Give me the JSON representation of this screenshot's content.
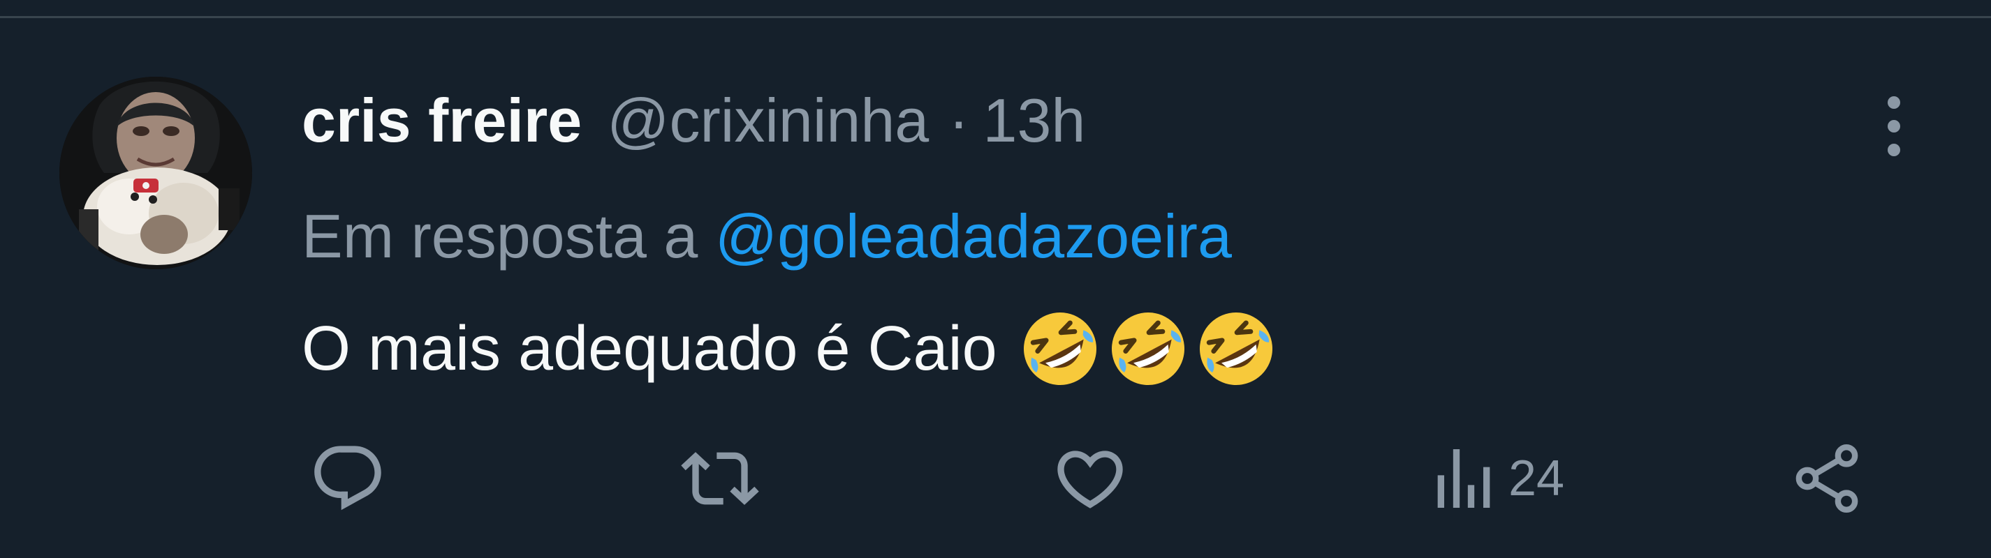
{
  "tweet": {
    "display_name": "cris freire",
    "handle": "@crixininha",
    "separator": "·",
    "timestamp": "13h",
    "reply_prefix": "Em resposta a",
    "reply_target": "@goleadadazoeira",
    "text": "O mais adequado é Caio",
    "emoji": [
      "rolling-on-floor-laughing",
      "rolling-on-floor-laughing",
      "rolling-on-floor-laughing"
    ]
  },
  "actions": {
    "reply_icon": "speech-bubble-icon",
    "retweet_icon": "retweet-icon",
    "like_icon": "heart-icon",
    "views_icon": "bar-chart-icon",
    "views_count": "24",
    "share_icon": "share-icon"
  },
  "menu": {
    "more_icon": "vertical-dots-icon"
  },
  "colors": {
    "background": "#15202b",
    "divider": "#38444d",
    "primary_text": "#f7f9f9",
    "secondary_text": "#8b98a5",
    "accent": "#1d9bf0",
    "icon": "#8b98a5",
    "emoji_face": "#f7c93b"
  }
}
